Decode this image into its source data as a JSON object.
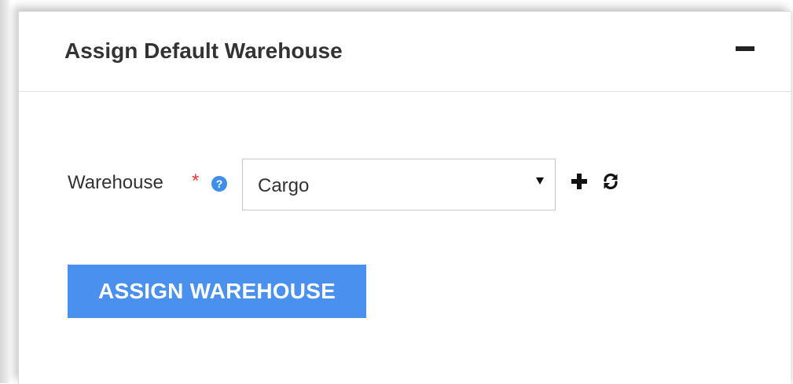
{
  "panel": {
    "title": "Assign Default Warehouse",
    "collapse_icon": "minus-icon"
  },
  "warehouse_field": {
    "label": "Warehouse",
    "required_marker": "*",
    "help_icon_glyph": "?",
    "selected_value": "Cargo",
    "add_icon": "plus-icon",
    "refresh_icon": "refresh-icon"
  },
  "actions": {
    "assign_label": "ASSIGN WAREHOUSE"
  },
  "colors": {
    "primary_button": "#4a90ee",
    "help_icon": "#3f8ee8",
    "required": "#e53935",
    "text": "#333333"
  }
}
